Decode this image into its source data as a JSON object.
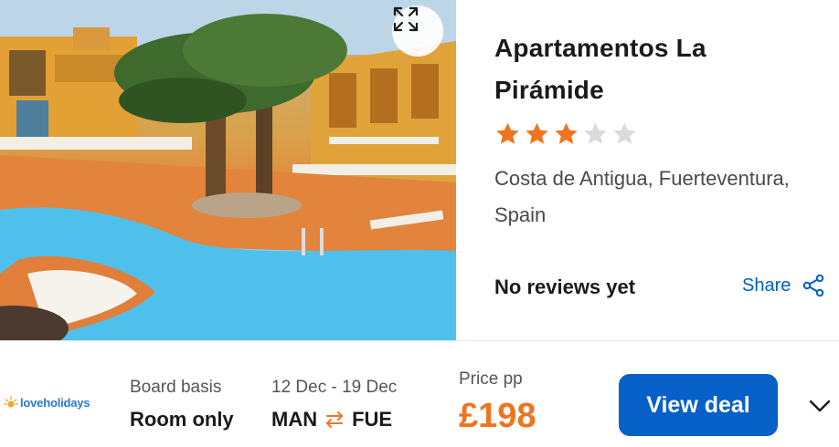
{
  "hotel": {
    "name": "Apartamentos La Pirámide",
    "star_rating": 3,
    "star_max": 5,
    "location": "Costa de Antigua, Fuerteventura, Spain",
    "reviews_text": "No reviews yet",
    "share_label": "Share"
  },
  "deal": {
    "provider": "loveholidays",
    "board_label": "Board basis",
    "board_value": "Room only",
    "dates": "12 Dec - 19 Dec",
    "origin": "MAN",
    "destination": "FUE",
    "price_label": "Price pp",
    "price": "£198",
    "cta_label": "View deal"
  },
  "icons": {
    "expand": "expand-icon",
    "star": "star-icon",
    "share": "share-icon",
    "swap": "swap-arrows-icon",
    "chevron": "chevron-down-icon",
    "logo": "sun-icon"
  },
  "colors": {
    "star_filled": "#ef7420",
    "star_empty": "#d9dbde",
    "price": "#ef7420",
    "cta": "#0660c8",
    "link": "#0060c4"
  }
}
